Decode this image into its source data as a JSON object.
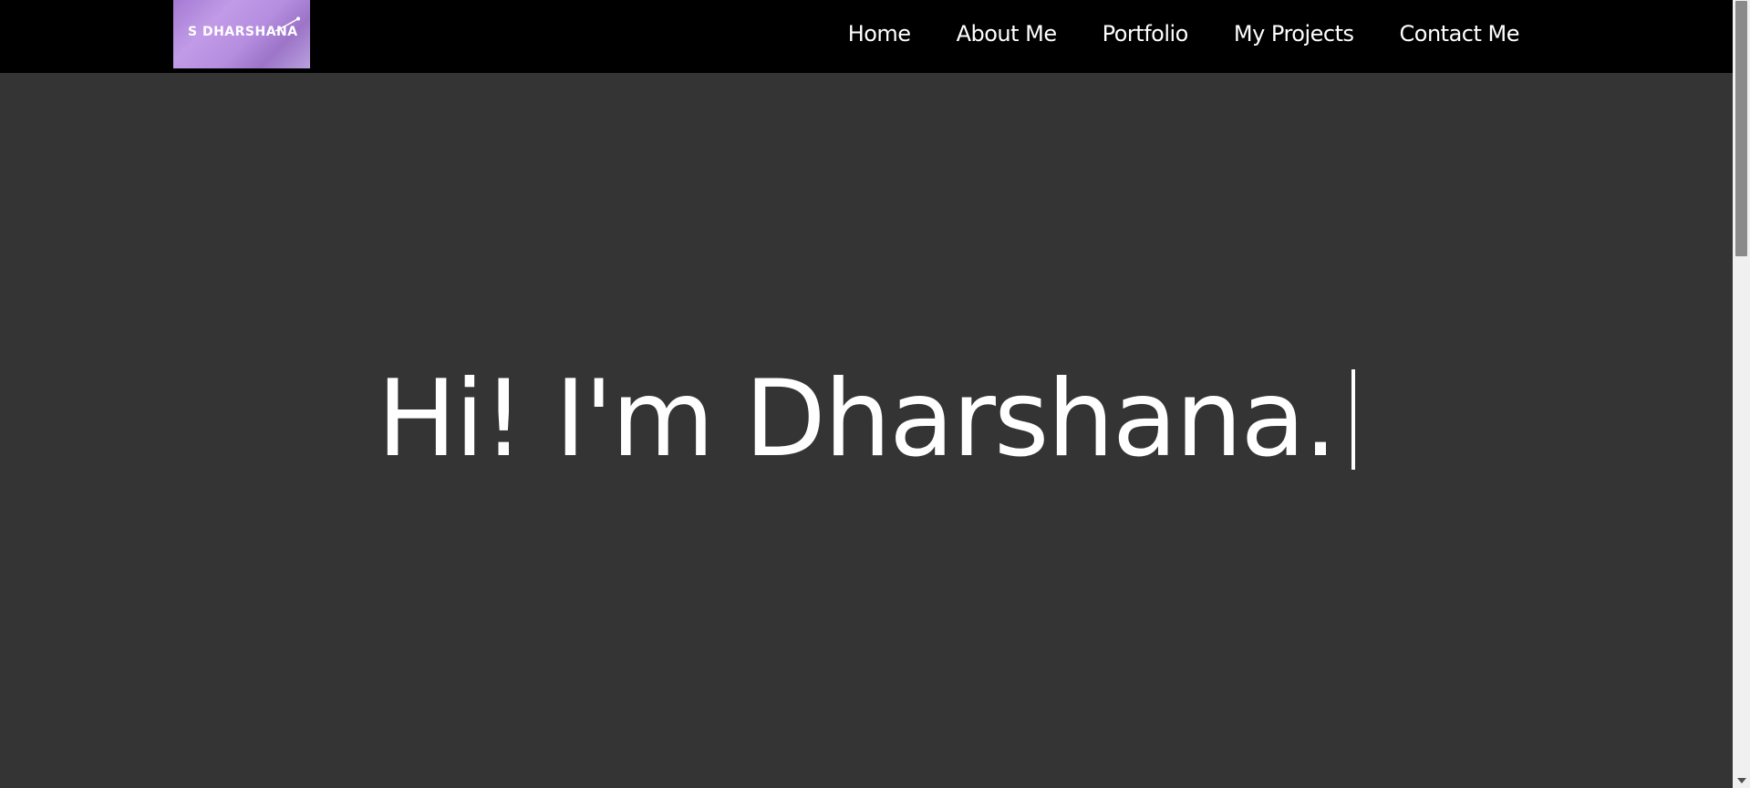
{
  "logo": {
    "text": "S DHARSHANA"
  },
  "nav": {
    "items": [
      {
        "label": "Home"
      },
      {
        "label": "About Me"
      },
      {
        "label": "Portfolio"
      },
      {
        "label": "My Projects"
      },
      {
        "label": "Contact Me"
      }
    ]
  },
  "hero": {
    "heading": "Hi! I'm Dharshana."
  },
  "colors": {
    "navbar_bg": "#000000",
    "page_bg": "#343434",
    "text": "#ffffff",
    "logo_accent": "#b58ee0"
  },
  "icons": {
    "cursor": "text-caret",
    "scroll_down": "chevron-down-icon"
  }
}
